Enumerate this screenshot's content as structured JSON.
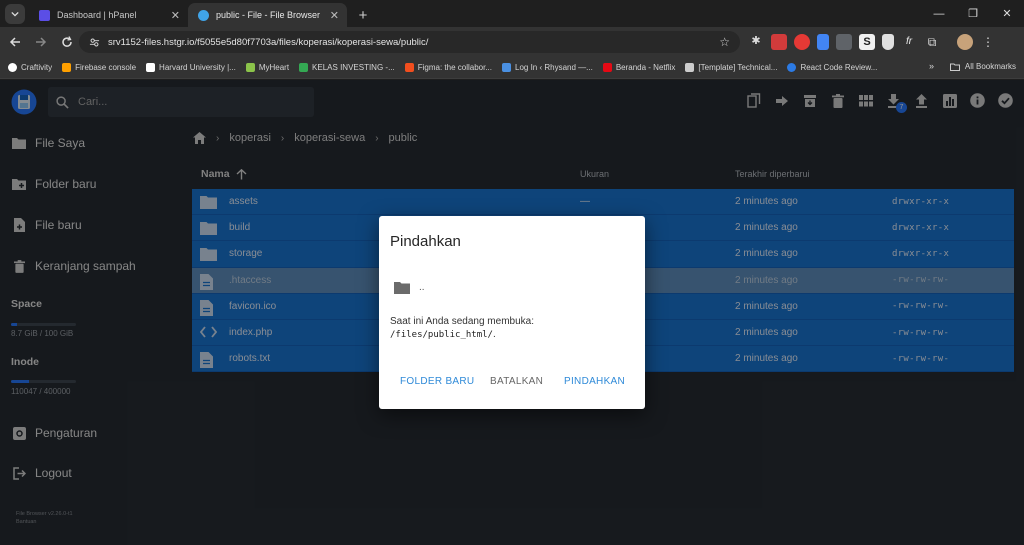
{
  "browser": {
    "tabs": [
      {
        "title": "Dashboard | hPanel",
        "active": false,
        "favicon_color": "#5b4ee6"
      },
      {
        "title": "public - File - File Browser",
        "active": true,
        "favicon_color": "#40a4e8"
      }
    ],
    "url": "srv1152-files.hstgr.io/f5055e5d80f7703a/files/koperasi/koperasi-sewa/public/",
    "bookmarks": [
      {
        "label": "Craftivity",
        "color": "#ffffff"
      },
      {
        "label": "Firebase console",
        "color": "#ffa000"
      },
      {
        "label": "Harvard University |...",
        "color": "#ffffff"
      },
      {
        "label": "MyHeart",
        "color": "#8bc34a"
      },
      {
        "label": "KELAS INVESTING -...",
        "color": "#34a853"
      },
      {
        "label": "Figma: the collabor...",
        "color": "#f24e1e"
      },
      {
        "label": "Log In ‹ Rhysand —...",
        "color": "#4a90e2"
      },
      {
        "label": "Beranda - Netflix",
        "color": "#e50914"
      },
      {
        "label": "[Template] Technical...",
        "color": "#cccccc"
      },
      {
        "label": "React Code Review...",
        "color": "#2c7be5"
      }
    ],
    "all_bookmarks": "All Bookmarks"
  },
  "app": {
    "search_placeholder": "Cari...",
    "notification_count": "7",
    "sidebar": {
      "items": [
        {
          "label": "File Saya",
          "icon": "folder-icon"
        },
        {
          "label": "Folder baru",
          "icon": "create-new-folder-icon"
        },
        {
          "label": "File baru",
          "icon": "note-add-icon"
        },
        {
          "label": "Keranjang sampah",
          "icon": "trash-icon"
        }
      ],
      "space": {
        "label": "Space",
        "text": "8.7 GiB / 100 GiB",
        "fraction": 0.087
      },
      "inode": {
        "label": "Inode",
        "text": "110047 / 400000",
        "fraction": 0.275
      },
      "settings": "Pengaturan",
      "logout": "Logout",
      "version": "File Browser v2.26.0-t1",
      "help": "Bantuan"
    },
    "breadcrumb": [
      "koperasi",
      "koperasi-sewa",
      "public"
    ],
    "columns": {
      "name": "Nama",
      "size": "Ukuran",
      "modified": "Terakhir diperbarui"
    },
    "files": [
      {
        "name": "assets",
        "type": "folder",
        "size": "—",
        "modified": "2 minutes ago",
        "perm": "drwxr-xr-x",
        "dim": false
      },
      {
        "name": "build",
        "type": "folder",
        "size": "",
        "modified": "2 minutes ago",
        "perm": "drwxr-xr-x",
        "dim": false
      },
      {
        "name": "storage",
        "type": "folder",
        "size": "",
        "modified": "2 minutes ago",
        "perm": "drwxr-xr-x",
        "dim": false
      },
      {
        "name": ".htaccess",
        "type": "file",
        "size": "",
        "modified": "2 minutes ago",
        "perm": "-rw-rw-rw-",
        "dim": true
      },
      {
        "name": "favicon.ico",
        "type": "file",
        "size": "",
        "modified": "2 minutes ago",
        "perm": "-rw-rw-rw-",
        "dim": false
      },
      {
        "name": "index.php",
        "type": "code",
        "size": "",
        "modified": "2 minutes ago",
        "perm": "-rw-rw-rw-",
        "dim": false
      },
      {
        "name": "robots.txt",
        "type": "file",
        "size": "",
        "modified": "2 minutes ago",
        "perm": "-rw-rw-rw-",
        "dim": false
      }
    ]
  },
  "modal": {
    "title": "Pindahkan",
    "parent_folder": "..",
    "message": "Saat ini Anda sedang membuka:",
    "path": "/files/public_html/",
    "path_suffix": ".",
    "buttons": {
      "new_folder": "FOLDER BARU",
      "cancel": "BATALKAN",
      "move": "PINDAHKAN"
    }
  }
}
